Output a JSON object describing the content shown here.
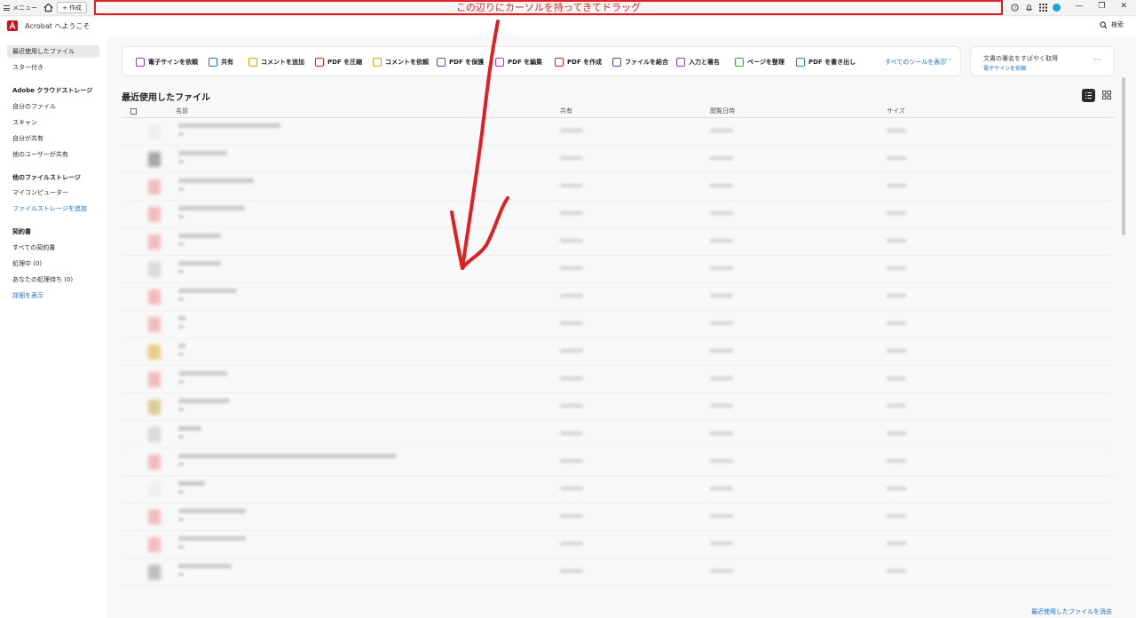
{
  "titlebar": {
    "menu_label": "メニュー",
    "create_tab_label": "作成",
    "annotation_text": "この辺りにカーソルを持ってきてドラッグ"
  },
  "appbar": {
    "title": "Acrobat へようこそ",
    "search_label": "検索"
  },
  "sidebar": {
    "recent": "最近使用したファイル",
    "starred": "スター付き",
    "cloud_head": "Adobe クラウドストレージ",
    "my_files": "自分のファイル",
    "scan": "スキャン",
    "shared_by_me": "自分が共有",
    "shared_by_others": "他のユーザーが共有",
    "other_storage_head": "他のファイルストレージ",
    "my_computer": "マイコンピューター",
    "add_storage": "ファイルストレージを追加",
    "agreements_head": "契約書",
    "all_agreements": "すべての契約書",
    "in_progress": "処理中 (0)",
    "waiting_for_you": "あなたの処理待ち (0)",
    "show_details": "詳細を表示"
  },
  "tools": {
    "items": [
      {
        "label": "電子サインを依頼",
        "color": "#a03ca0"
      },
      {
        "label": "共有",
        "color": "#1a6fd1"
      },
      {
        "label": "コメントを追加",
        "color": "#d9a400"
      },
      {
        "label": "PDF を圧縮",
        "color": "#d62020"
      },
      {
        "label": "コメントを依頼",
        "color": "#d9a400"
      },
      {
        "label": "PDF を保護",
        "color": "#4b4bb8"
      },
      {
        "label": "PDF を編集",
        "color": "#c0309a"
      },
      {
        "label": "PDF を作成",
        "color": "#d62020"
      },
      {
        "label": "ファイルを結合",
        "color": "#4b4bb8"
      },
      {
        "label": "入力と署名",
        "color": "#7a3cc0"
      },
      {
        "label": "ページを整理",
        "color": "#3aa33a"
      },
      {
        "label": "PDF を書き出し",
        "color": "#1a8a9a"
      }
    ],
    "all_tools": "すべてのツールを表示"
  },
  "sign_card": {
    "title": "文書の署名をすばやく取得",
    "link": "電子サインを依頼"
  },
  "files": {
    "section_title": "最近使用したファイル",
    "columns": {
      "name": "名前",
      "shared": "共有",
      "opened": "閲覧日時",
      "size": "サイズ"
    },
    "clear_link": "最近使用したファイルを消去"
  },
  "colors": {
    "annotation": "#e02020",
    "link": "#1a6fd1",
    "acrobat_red": "#c8141e"
  }
}
